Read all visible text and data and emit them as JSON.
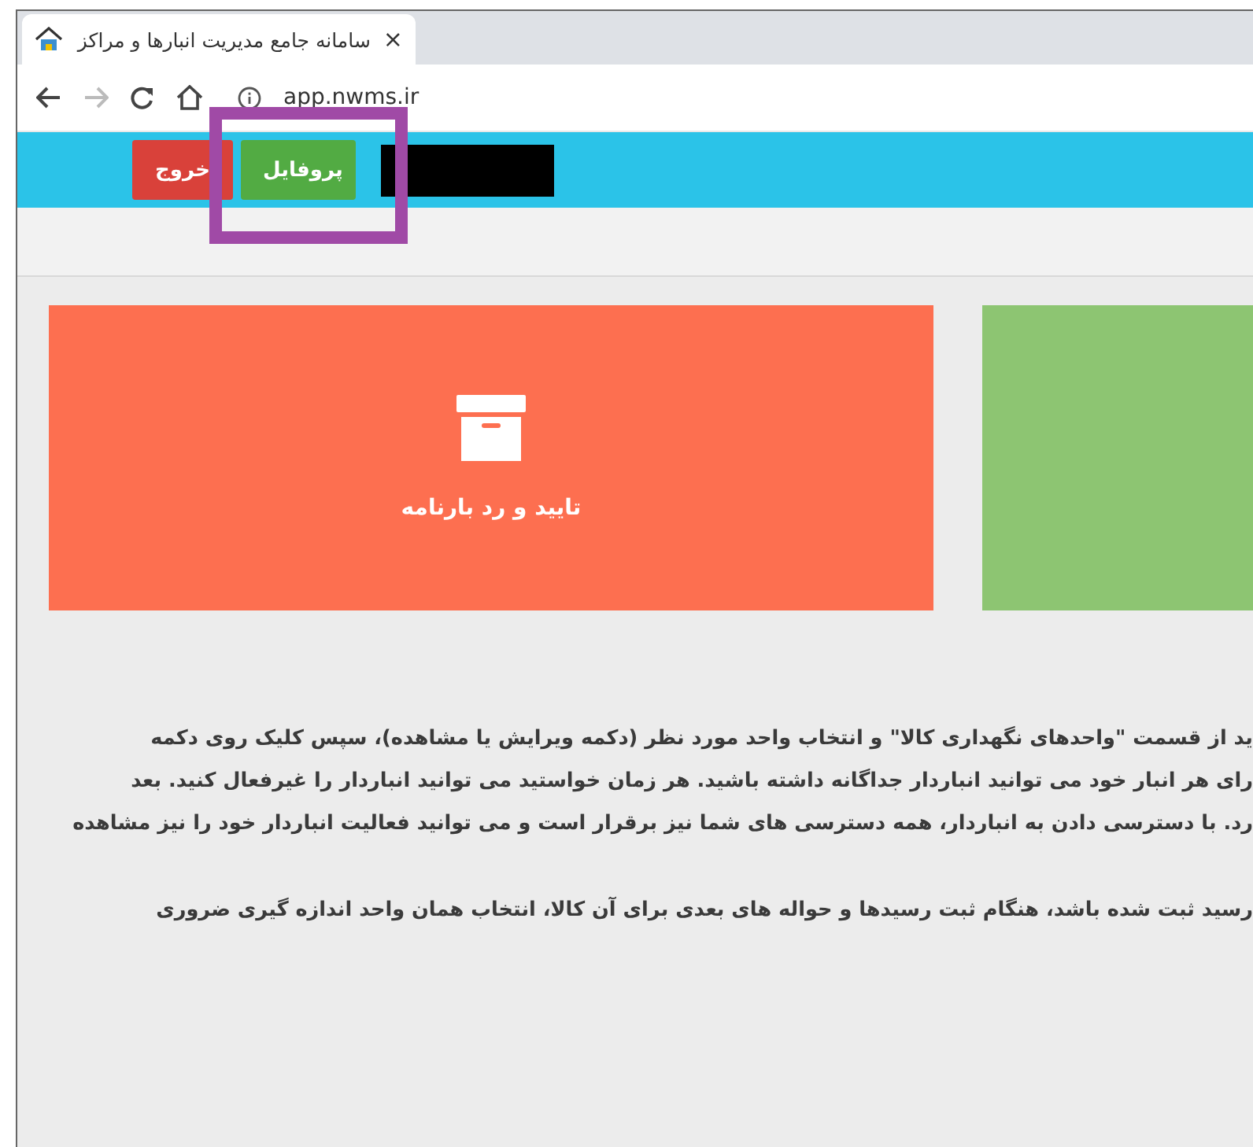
{
  "browser": {
    "tab": {
      "title": "سامانه جامع مدیریت انبارها و مراکز",
      "close": "×"
    },
    "url": "app.nwms.ir"
  },
  "nav": {
    "buttons": [
      {
        "label": "پروفایل",
        "kind": "success"
      },
      {
        "label": "خروج",
        "kind": "danger"
      }
    ]
  },
  "cards": [
    {
      "title": "تایید و رد بارنامه",
      "color": "#fd6f50"
    },
    {
      "color": "#8dc572"
    }
  ],
  "paragraphs": [
    {
      "lines": [
        "ید از قسمت \"واحدهای نگهداری کالا\" و انتخاب واحد مورد نظر (دکمه ویرایش یا مشاهده)، سپس کلیک روی دکمه",
        "رای هر انبار خود می توانید انباردار جداگانه داشته باشید. هر زمان خواستید می توانید انباردار را غیرفعال کنید. بعد",
        "رد. با دسترسی دادن به انباردار، همه دسترسی های شما نیز برقرار است و می توانید فعالیت انباردار خود را نیز مشاهده"
      ]
    },
    {
      "lines": [
        "رسید ثبت شده باشد، هنگام ثبت رسیدها و حواله های بعدی برای آن کالا، انتخاب همان واحد اندازه گیری ضروری"
      ]
    }
  ]
}
